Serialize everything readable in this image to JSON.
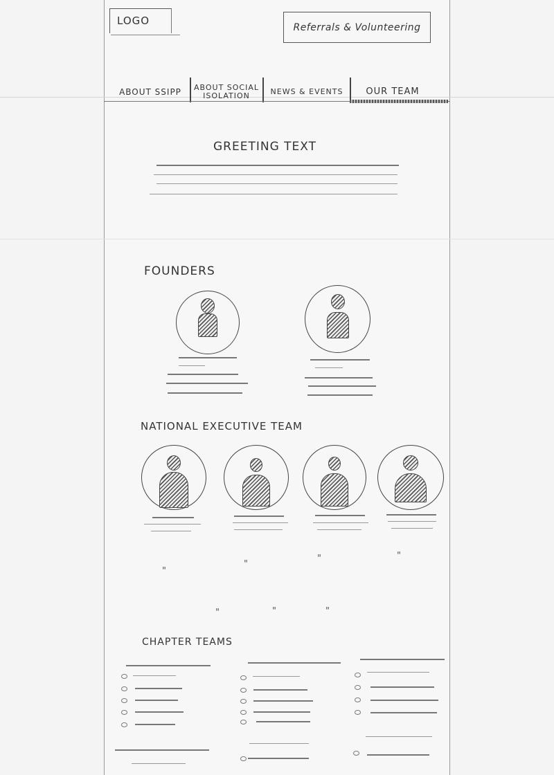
{
  "header": {
    "logo_label": "LOGO",
    "cta_label": "Referrals & Volunteering"
  },
  "nav": {
    "items": [
      {
        "label": "ABOUT SSIPP"
      },
      {
        "label": "ABOUT SOCIAL ISOLATION"
      },
      {
        "label": "NEWS & EVENTS"
      },
      {
        "label": "OUR TEAM",
        "active": true
      }
    ]
  },
  "intro": {
    "title": "GREETING TEXT"
  },
  "founders": {
    "title": "FOUNDERS"
  },
  "executive": {
    "title": "NATIONAL EXECUTIVE TEAM"
  },
  "chapters": {
    "title": "CHAPTER TEAMS"
  },
  "ditto_marks": [
    "\"",
    "\"",
    "\"",
    "\"",
    "\"",
    "\"",
    "\""
  ]
}
